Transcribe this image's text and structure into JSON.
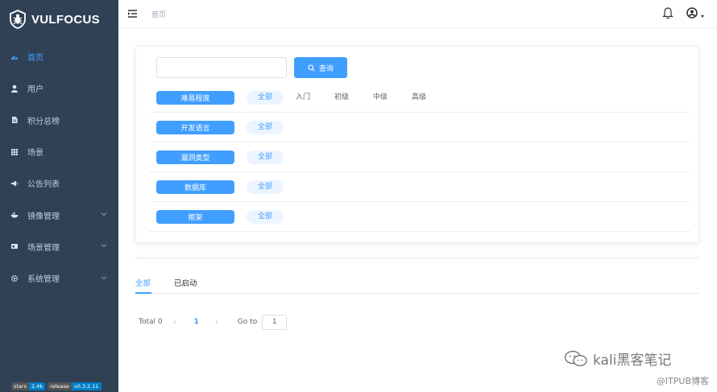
{
  "sidebar": {
    "brand": "VULFOCUS",
    "items": [
      {
        "label": "首页",
        "icon": "dashboard-icon",
        "active": true
      },
      {
        "label": "用户",
        "icon": "user-icon"
      },
      {
        "label": "积分总榜",
        "icon": "document-icon"
      },
      {
        "label": "场景",
        "icon": "grid-icon"
      },
      {
        "label": "公告列表",
        "icon": "megaphone-icon"
      },
      {
        "label": "镜像管理",
        "icon": "docker-icon",
        "expandable": true
      },
      {
        "label": "场景管理",
        "icon": "window-icon",
        "expandable": true
      },
      {
        "label": "系统管理",
        "icon": "gear-icon",
        "expandable": true
      }
    ],
    "badges": [
      {
        "key": "stars",
        "value": "2.4k"
      },
      {
        "key": "release",
        "value": "v0.3.2.11"
      }
    ]
  },
  "topbar": {
    "breadcrumb": "首页"
  },
  "filter": {
    "search_placeholder": "",
    "search_button": "查询",
    "rows": [
      {
        "tag": "难易程度",
        "all": "全部",
        "options": [
          "入门",
          "初级",
          "中级",
          "高级"
        ]
      },
      {
        "tag": "开发语言",
        "all": "全部",
        "options": []
      },
      {
        "tag": "漏洞类型",
        "all": "全部",
        "options": []
      },
      {
        "tag": "数据库",
        "all": "全部",
        "options": []
      },
      {
        "tag": "框架",
        "all": "全部",
        "options": []
      }
    ]
  },
  "tabs": [
    {
      "label": "全部",
      "active": true
    },
    {
      "label": "已启动",
      "active": false
    }
  ],
  "pagination": {
    "total": "Total 0",
    "prev": "‹",
    "page": "1",
    "next": "›",
    "goto_label": "Go to",
    "goto_value": "1"
  },
  "watermark": {
    "line1": "kali黑客笔记",
    "line2": "@ITPUB博客"
  },
  "colors": {
    "sidebar_bg": "#304156",
    "accent": "#409eff"
  }
}
